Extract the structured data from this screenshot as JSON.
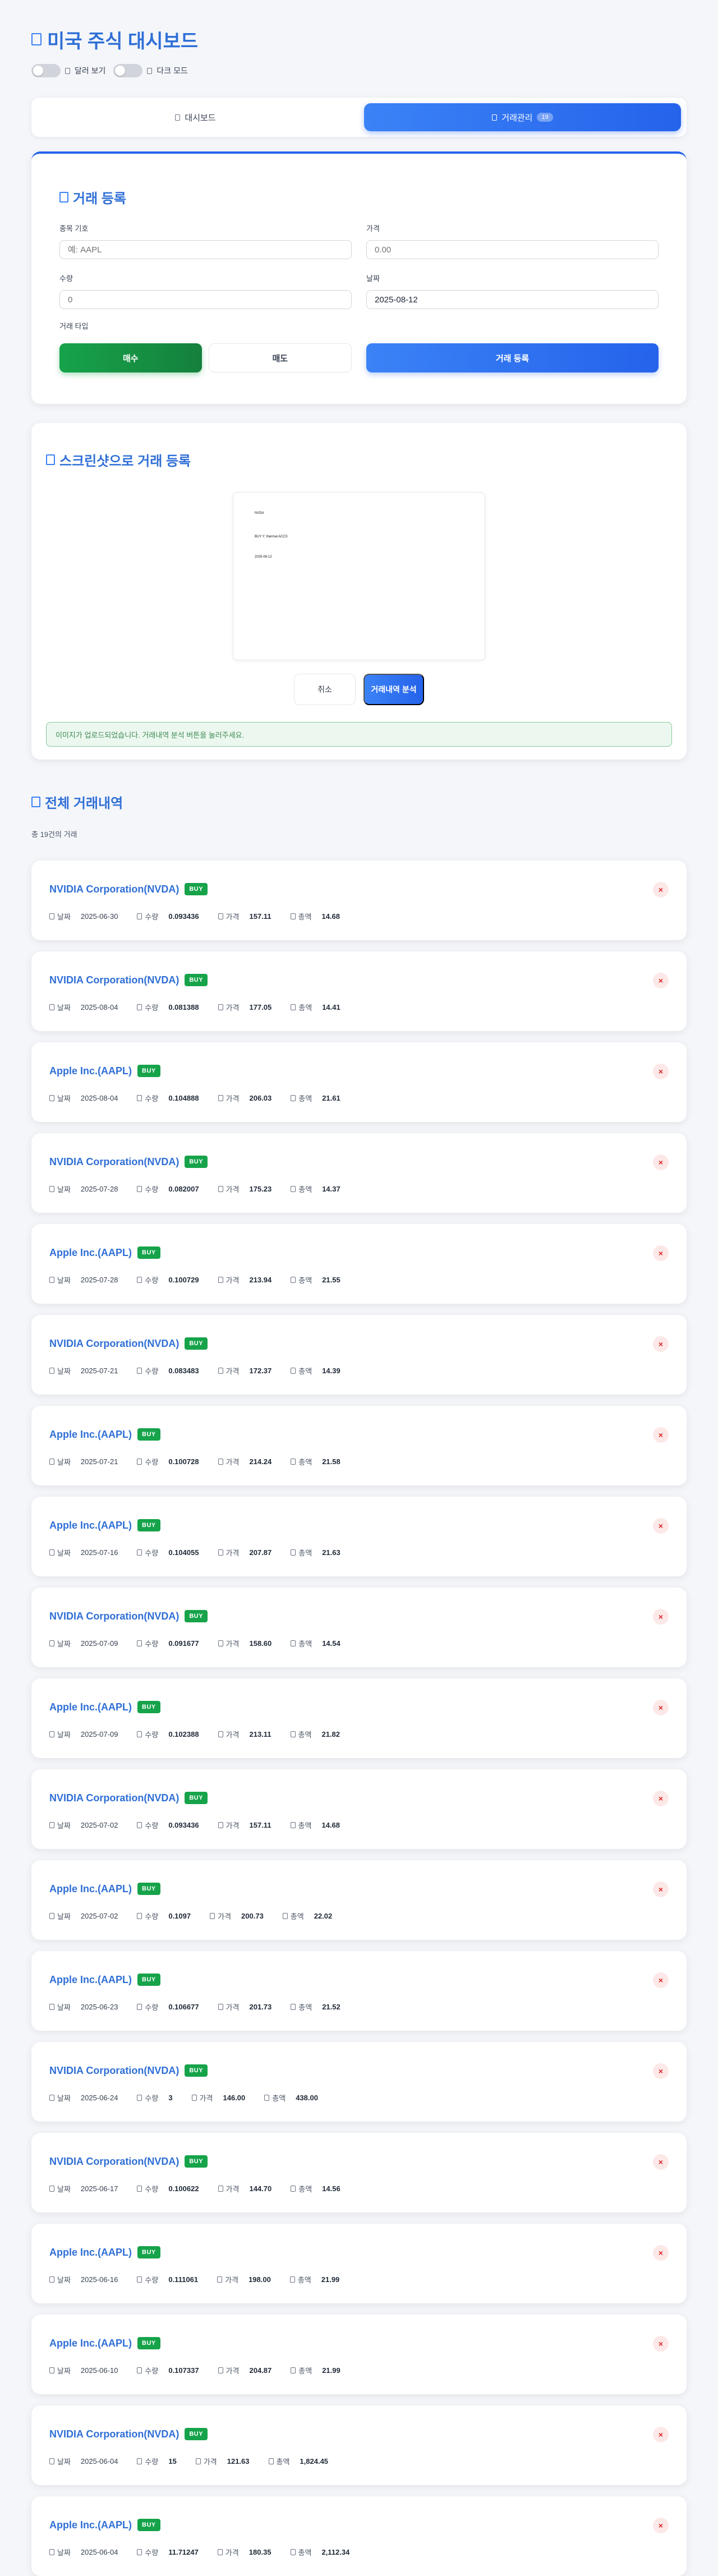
{
  "header": {
    "title": "미국 주식 대시보드",
    "toggle_dollar": "달러 보기",
    "toggle_dark": "다크 모드"
  },
  "tabs": {
    "dashboard": "대시보드",
    "trades": "거래관리",
    "trades_badge": "19"
  },
  "trade_form": {
    "title": "거래 등록",
    "symbol_label": "종목 기호",
    "symbol_placeholder": "예: AAPL",
    "price_label": "가격",
    "price_placeholder": "0.00",
    "qty_label": "수량",
    "qty_placeholder": "0",
    "date_label": "날짜",
    "date_value": "2025-08-12",
    "type_label": "거래 타입",
    "buy_label": "매수",
    "sell_label": "매도",
    "submit_label": "거래 등록"
  },
  "screenshot": {
    "title": "스크린샷으로 거래 등록",
    "preview_lines": [
      "NVDA",
      "BUY Y: thermal ACCS",
      "2025-06-12"
    ],
    "cancel_label": "취소",
    "analyze_label": "거래내역 분석",
    "notice": "이미지가 업로드되었습니다. 거래내역 분석 버튼을 눌러주세요."
  },
  "history": {
    "title": "전체 거래내역",
    "count": "총 19건의 거래",
    "labels": {
      "date": "날짜",
      "qty": "수량",
      "price": "가격",
      "total": "총액"
    },
    "delete_label": "×",
    "trades": [
      {
        "name": "NVIDIA Corporation(NVDA)",
        "type": "BUY",
        "date": "2025-06-30",
        "qty": "0.093436",
        "price": "157.11",
        "total": "14.68"
      },
      {
        "name": "NVIDIA Corporation(NVDA)",
        "type": "BUY",
        "date": "2025-08-04",
        "qty": "0.081388",
        "price": "177.05",
        "total": "14.41"
      },
      {
        "name": "Apple Inc.(AAPL)",
        "type": "BUY",
        "date": "2025-08-04",
        "qty": "0.104888",
        "price": "206.03",
        "total": "21.61"
      },
      {
        "name": "NVIDIA Corporation(NVDA)",
        "type": "BUY",
        "date": "2025-07-28",
        "qty": "0.082007",
        "price": "175.23",
        "total": "14.37"
      },
      {
        "name": "Apple Inc.(AAPL)",
        "type": "BUY",
        "date": "2025-07-28",
        "qty": "0.100729",
        "price": "213.94",
        "total": "21.55"
      },
      {
        "name": "NVIDIA Corporation(NVDA)",
        "type": "BUY",
        "date": "2025-07-21",
        "qty": "0.083483",
        "price": "172.37",
        "total": "14.39"
      },
      {
        "name": "Apple Inc.(AAPL)",
        "type": "BUY",
        "date": "2025-07-21",
        "qty": "0.100728",
        "price": "214.24",
        "total": "21.58"
      },
      {
        "name": "Apple Inc.(AAPL)",
        "type": "BUY",
        "date": "2025-07-16",
        "qty": "0.104055",
        "price": "207.87",
        "total": "21.63"
      },
      {
        "name": "NVIDIA Corporation(NVDA)",
        "type": "BUY",
        "date": "2025-07-09",
        "qty": "0.091677",
        "price": "158.60",
        "total": "14.54"
      },
      {
        "name": "Apple Inc.(AAPL)",
        "type": "BUY",
        "date": "2025-07-09",
        "qty": "0.102388",
        "price": "213.11",
        "total": "21.82"
      },
      {
        "name": "NVIDIA Corporation(NVDA)",
        "type": "BUY",
        "date": "2025-07-02",
        "qty": "0.093436",
        "price": "157.11",
        "total": "14.68"
      },
      {
        "name": "Apple Inc.(AAPL)",
        "type": "BUY",
        "date": "2025-07-02",
        "qty": "0.1097",
        "price": "200.73",
        "total": "22.02"
      },
      {
        "name": "Apple Inc.(AAPL)",
        "type": "BUY",
        "date": "2025-06-23",
        "qty": "0.106677",
        "price": "201.73",
        "total": "21.52"
      },
      {
        "name": "NVIDIA Corporation(NVDA)",
        "type": "BUY",
        "date": "2025-06-24",
        "qty": "3",
        "price": "146.00",
        "total": "438.00"
      },
      {
        "name": "NVIDIA Corporation(NVDA)",
        "type": "BUY",
        "date": "2025-06-17",
        "qty": "0.100622",
        "price": "144.70",
        "total": "14.56"
      },
      {
        "name": "Apple Inc.(AAPL)",
        "type": "BUY",
        "date": "2025-06-16",
        "qty": "0.111061",
        "price": "198.00",
        "total": "21.99"
      },
      {
        "name": "Apple Inc.(AAPL)",
        "type": "BUY",
        "date": "2025-06-10",
        "qty": "0.107337",
        "price": "204.87",
        "total": "21.99"
      },
      {
        "name": "NVIDIA Corporation(NVDA)",
        "type": "BUY",
        "date": "2025-06-04",
        "qty": "15",
        "price": "121.63",
        "total": "1,824.45"
      },
      {
        "name": "Apple Inc.(AAPL)",
        "type": "BUY",
        "date": "2025-06-04",
        "qty": "11.71247",
        "price": "180.35",
        "total": "2,112.34"
      }
    ]
  }
}
